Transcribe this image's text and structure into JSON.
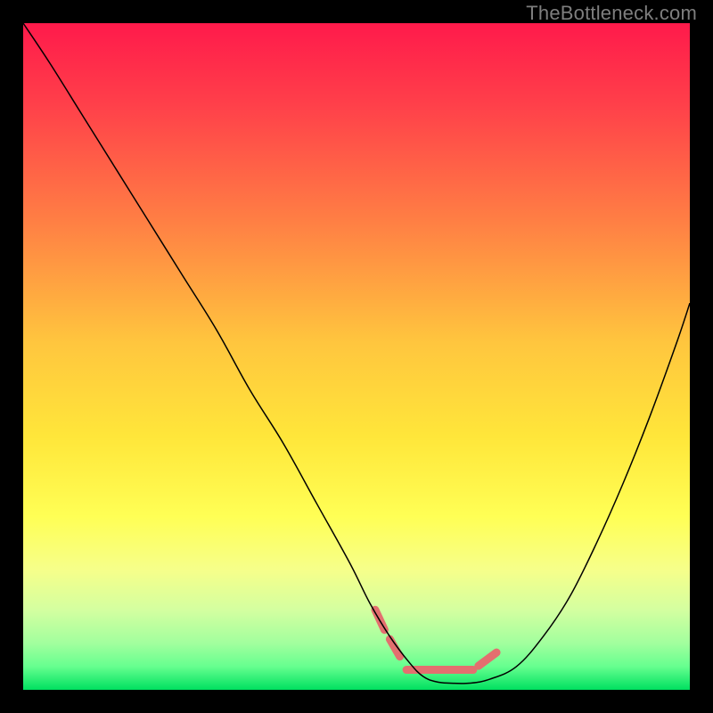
{
  "watermark": "TheBottleneck.com",
  "chart_data": {
    "type": "line",
    "title": "",
    "xlabel": "",
    "ylabel": "",
    "xlim": [
      0,
      100
    ],
    "ylim": [
      0,
      100
    ],
    "gradient_stops": [
      {
        "offset": 0.0,
        "color": "#ff1a4b"
      },
      {
        "offset": 0.12,
        "color": "#ff3f4a"
      },
      {
        "offset": 0.3,
        "color": "#ff8044"
      },
      {
        "offset": 0.48,
        "color": "#ffc63e"
      },
      {
        "offset": 0.62,
        "color": "#ffe63a"
      },
      {
        "offset": 0.74,
        "color": "#ffff55"
      },
      {
        "offset": 0.82,
        "color": "#f6ff8a"
      },
      {
        "offset": 0.88,
        "color": "#d4ffa0"
      },
      {
        "offset": 0.93,
        "color": "#a2ff9e"
      },
      {
        "offset": 0.965,
        "color": "#66ff8f"
      },
      {
        "offset": 1.0,
        "color": "#00e060"
      }
    ],
    "series": [
      {
        "name": "bottleneck-curve",
        "color": "#000000",
        "width": 1.5,
        "x": [
          0,
          4,
          9,
          14,
          19,
          24,
          29,
          34,
          39,
          44,
          49,
          52,
          55,
          58,
          60,
          62,
          64,
          67,
          70,
          74,
          78,
          82,
          86,
          90,
          94,
          98,
          100
        ],
        "y": [
          100,
          94,
          86,
          78,
          70,
          62,
          54,
          45,
          37,
          28,
          19,
          13,
          8,
          4,
          2,
          1.2,
          1.0,
          1.0,
          1.6,
          3.5,
          8,
          14,
          22,
          31,
          41,
          52,
          58
        ]
      },
      {
        "name": "flat-region-marker",
        "color": "#e36f6f",
        "width": 9,
        "linecap": "round",
        "segments": [
          {
            "x": [
              52.8,
              54.2
            ],
            "y": [
              12.0,
              9.0
            ]
          },
          {
            "x": [
              55.0,
              56.5
            ],
            "y": [
              7.6,
              5.0
            ]
          },
          {
            "x": [
              57.5,
              67.5
            ],
            "y": [
              3.0,
              3.0
            ]
          },
          {
            "x": [
              68.3,
              71.0
            ],
            "y": [
              3.6,
              5.6
            ]
          }
        ]
      }
    ]
  }
}
